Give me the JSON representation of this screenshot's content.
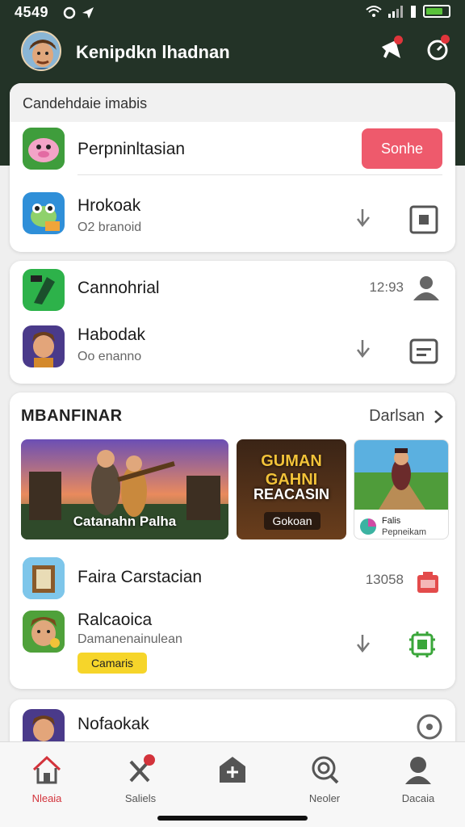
{
  "status": {
    "time": "4549",
    "battery_level": 0.75
  },
  "header": {
    "user_name": "Kenipdkn lhadnan"
  },
  "colors": {
    "header_bg": "#233327",
    "accent": "#ee5a6c",
    "badge": "#f6d52a",
    "active_tab": "#d3333b"
  },
  "card1": {
    "header": "Candehdaie imabis",
    "items": [
      {
        "title": "Perpninltasian",
        "button": "Sonhe"
      },
      {
        "title": "Hrokoak",
        "subtitle": "O2 branoid"
      }
    ]
  },
  "card2": {
    "items": [
      {
        "title": "Cannohrial",
        "count": "12:93"
      },
      {
        "title": "Habodak",
        "subtitle": "Oo enanno"
      }
    ]
  },
  "card3": {
    "title": "MBANFINAR",
    "see_all": "Darlsan",
    "banners": [
      {
        "label": "Catanahn Palha"
      },
      {
        "title": "GUMAN GAHNI",
        "label": "REACASIN",
        "button": "Gokoan"
      },
      {
        "label": "Falis",
        "sub": "Pepneikam"
      }
    ],
    "items": [
      {
        "title": "Faira Carstacian",
        "count": "13058"
      },
      {
        "title": "Ralcaoica",
        "subtitle": "Damanenainulean",
        "badge": "Camaris"
      }
    ]
  },
  "card4": {
    "items": [
      {
        "title": "Nofaokak"
      }
    ]
  },
  "tabs": [
    {
      "label": "Nleaia",
      "icon": "home-icon"
    },
    {
      "label": "Saliels",
      "icon": "tools-icon"
    },
    {
      "label": "",
      "icon": "medical-icon"
    },
    {
      "label": "Neoler",
      "icon": "search-icon"
    },
    {
      "label": "Dacaia",
      "icon": "profile-icon"
    }
  ]
}
